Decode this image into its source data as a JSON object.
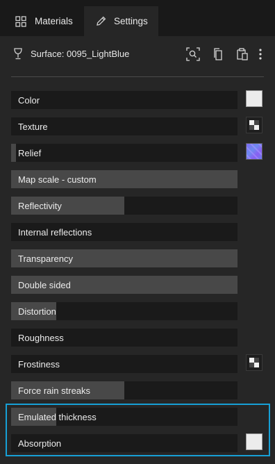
{
  "tabs": [
    {
      "label": "Materials",
      "icon": "grid-icon"
    },
    {
      "label": "Settings",
      "icon": "pencil-icon",
      "active": true
    }
  ],
  "surface": {
    "label": "Surface: 0095_LightBlue",
    "icon": "goblet-icon",
    "toolbar": [
      "zoom-select-icon",
      "copy-icon",
      "paste-icon",
      "more-vertical-icon"
    ]
  },
  "colors": {
    "accent": "#17a0d6",
    "background": "#262626",
    "slider_track": "#1a1a1a",
    "slider_fill": "#484848"
  },
  "properties": [
    {
      "label": "Color",
      "fill_percent": 0,
      "swatch": "white"
    },
    {
      "label": "Texture",
      "fill_percent": 0,
      "swatch": "checker"
    },
    {
      "label": "Relief",
      "fill_percent": 2,
      "swatch": "normal-map"
    },
    {
      "label": "Map scale - custom",
      "fill_percent": 100,
      "swatch": ""
    },
    {
      "label": "Reflectivity",
      "fill_percent": 50,
      "swatch": ""
    },
    {
      "label": "Internal reflections",
      "fill_percent": 0,
      "swatch": ""
    },
    {
      "label": "Transparency",
      "fill_percent": 100,
      "swatch": ""
    },
    {
      "label": "Double sided",
      "fill_percent": 100,
      "swatch": ""
    },
    {
      "label": "Distortion",
      "fill_percent": 20,
      "swatch": ""
    },
    {
      "label": "Roughness",
      "fill_percent": 0,
      "swatch": ""
    },
    {
      "label": "Frostiness",
      "fill_percent": 0,
      "swatch": "checker"
    },
    {
      "label": "Force rain streaks",
      "fill_percent": 50,
      "swatch": ""
    },
    {
      "label": "Emulated thickness",
      "fill_percent": 20,
      "swatch": ""
    },
    {
      "label": "Absorption",
      "fill_percent": 0,
      "swatch": "white"
    }
  ]
}
